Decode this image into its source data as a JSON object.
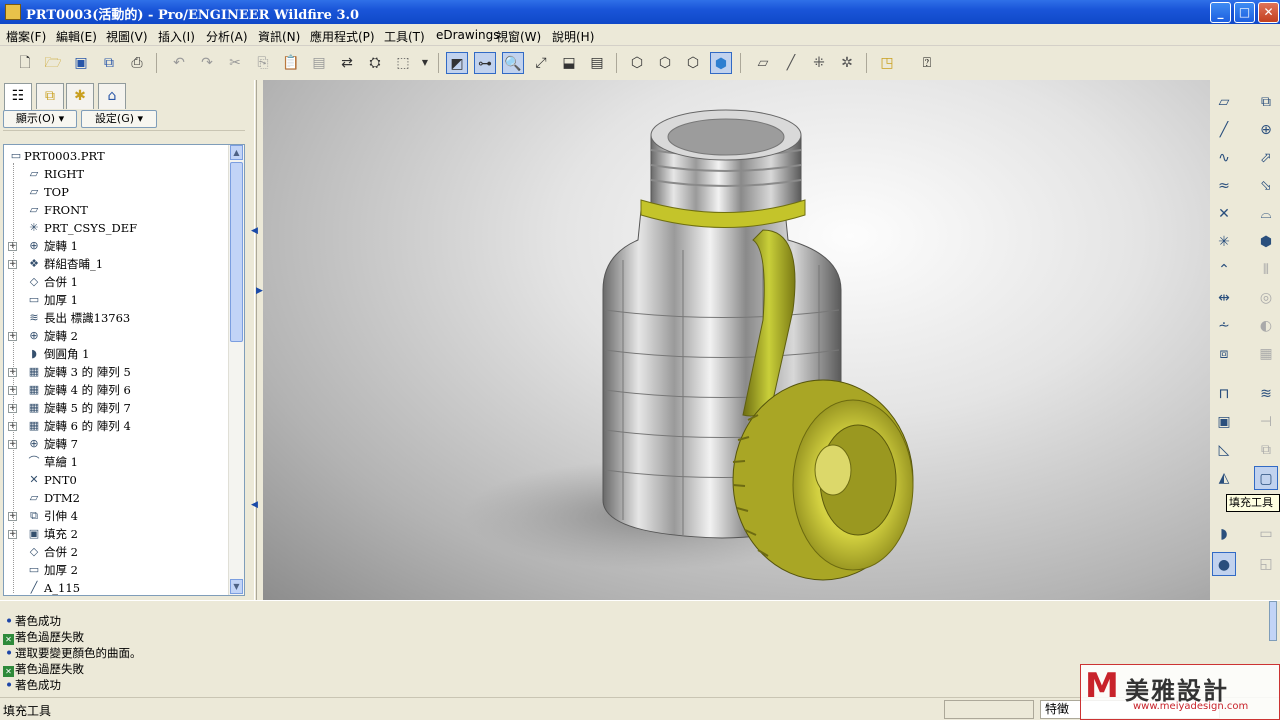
{
  "window": {
    "title": "PRT0003(活動的) - Pro/ENGINEER Wildfire 3.0",
    "minimize": "_",
    "maximize": "□",
    "close": "✕"
  },
  "menu": [
    "檔案(F)",
    "編輯(E)",
    "視圖(V)",
    "插入(I)",
    "分析(A)",
    "資訊(N)",
    "應用程式(P)",
    "工具(T)",
    "eDrawings",
    "視窗(W)",
    "說明(H)"
  ],
  "left_panel": {
    "show_button": "顯示(O) ▾",
    "settings_button": "設定(G) ▾",
    "tree": [
      {
        "label": "PRT0003.PRT",
        "icon": "part-icon",
        "glyph": "▭",
        "expandable": false
      },
      {
        "label": "RIGHT",
        "icon": "datum-plane-icon",
        "glyph": "▱",
        "expandable": false
      },
      {
        "label": "TOP",
        "icon": "datum-plane-icon",
        "glyph": "▱",
        "expandable": false
      },
      {
        "label": "FRONT",
        "icon": "datum-plane-icon",
        "glyph": "▱",
        "expandable": false
      },
      {
        "label": "PRT_CSYS_DEF",
        "icon": "csys-icon",
        "glyph": "✳",
        "expandable": false
      },
      {
        "label": "旋轉 1",
        "icon": "revolve-icon",
        "glyph": "⊕",
        "expandable": true
      },
      {
        "label": "群組杳晡_1",
        "icon": "group-icon",
        "glyph": "❖",
        "expandable": true
      },
      {
        "label": "合併 1",
        "icon": "merge-icon",
        "glyph": "◇",
        "expandable": false
      },
      {
        "label": "加厚 1",
        "icon": "thicken-icon",
        "glyph": "▭",
        "expandable": false
      },
      {
        "label": "長出 標識13763",
        "icon": "protrusion-icon",
        "glyph": "≋",
        "expandable": false
      },
      {
        "label": "旋轉 2",
        "icon": "revolve-icon",
        "glyph": "⊕",
        "expandable": true
      },
      {
        "label": "倒圓角 1",
        "icon": "round-icon",
        "glyph": "◗",
        "expandable": false
      },
      {
        "label": "旋轉 3 的 陣列 5",
        "icon": "pattern-icon",
        "glyph": "▦",
        "expandable": true
      },
      {
        "label": "旋轉 4 的 陣列 6",
        "icon": "pattern-icon",
        "glyph": "▦",
        "expandable": true
      },
      {
        "label": "旋轉 5 的 陣列 7",
        "icon": "pattern-icon",
        "glyph": "▦",
        "expandable": true
      },
      {
        "label": "旋轉 6 的 陣列 4",
        "icon": "pattern-icon",
        "glyph": "▦",
        "expandable": true
      },
      {
        "label": "旋轉 7",
        "icon": "revolve-icon",
        "glyph": "⊕",
        "expandable": true
      },
      {
        "label": "草繪 1",
        "icon": "sketch-icon",
        "glyph": "⌒",
        "expandable": false
      },
      {
        "label": "PNT0",
        "icon": "datum-point-icon",
        "glyph": "✕",
        "expandable": false
      },
      {
        "label": "DTM2",
        "icon": "datum-plane-icon",
        "glyph": "▱",
        "expandable": false
      },
      {
        "label": "引伸 4",
        "icon": "extrude-icon",
        "glyph": "⧉",
        "expandable": true
      },
      {
        "label": "填充 2",
        "icon": "fill-icon",
        "glyph": "▣",
        "expandable": true
      },
      {
        "label": "合併 2",
        "icon": "merge-icon",
        "glyph": "◇",
        "expandable": false
      },
      {
        "label": "加厚 2",
        "icon": "thicken-icon",
        "glyph": "▭",
        "expandable": false
      },
      {
        "label": "A_115",
        "icon": "axis-icon",
        "glyph": "╱",
        "expandable": false
      }
    ]
  },
  "messages": [
    {
      "type": "info",
      "text": "著色成功"
    },
    {
      "type": "warn",
      "text": "著色過歷失敗"
    },
    {
      "type": "info",
      "text": "選取要變更顏色的曲面。"
    },
    {
      "type": "warn",
      "text": "著色過歷失敗"
    },
    {
      "type": "info",
      "text": "著色成功"
    }
  ],
  "tooltip": "填充工具",
  "status": {
    "text": "填充工具",
    "filter": "特徵"
  },
  "watermark": {
    "logo": "M",
    "name": "美雅設計",
    "url": "www.meiyadesign.com"
  },
  "colors": {
    "titlebar": "#1a55d8",
    "cap_green": "#b8c22a",
    "viewport_bg": "#bdbdbd"
  }
}
